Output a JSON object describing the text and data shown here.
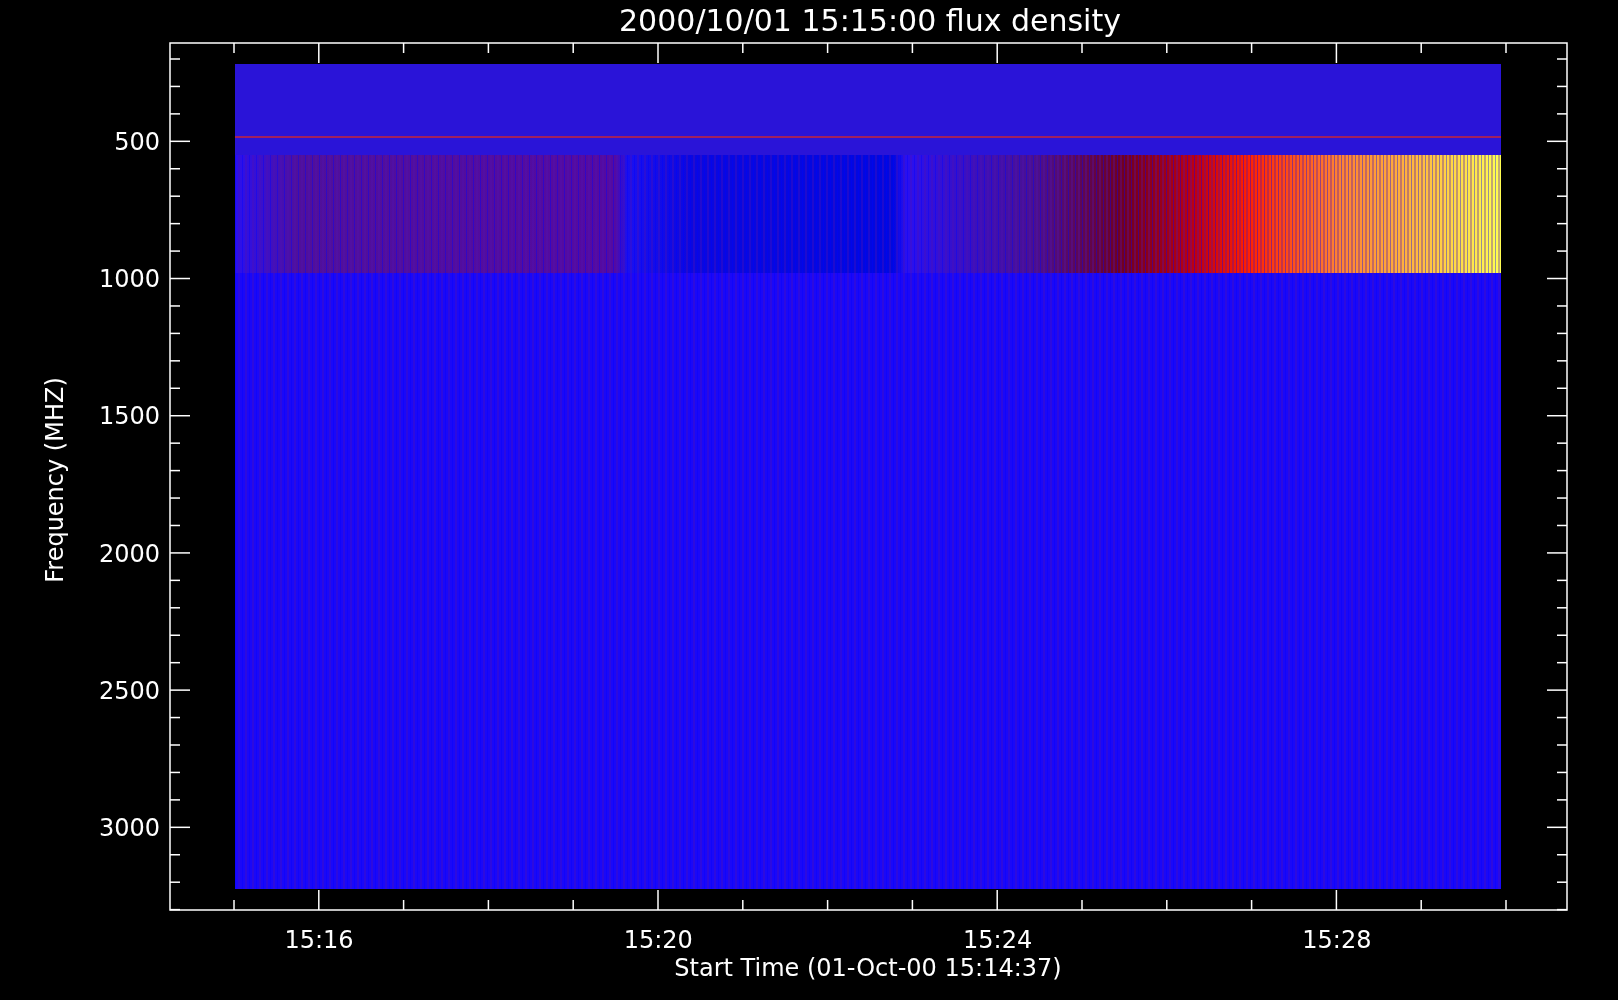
{
  "plot": {
    "title": "2000/10/01 15:15:00 flux density",
    "y_axis": {
      "label": "Frequency (MHZ)",
      "ticks": [
        "500",
        "1000",
        "1500",
        "2000",
        "2500",
        "3000"
      ]
    },
    "x_axis": {
      "label": "Start Time (01-Oct-00 15:14:37)",
      "ticks": [
        "15:16",
        "15:20",
        "15:24",
        "15:28"
      ]
    }
  }
}
